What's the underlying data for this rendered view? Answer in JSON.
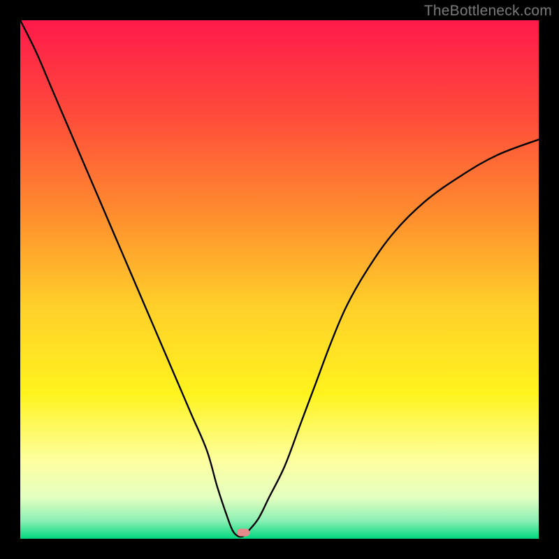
{
  "watermark": "TheBottleneck.com",
  "chart_data": {
    "type": "line",
    "title": "",
    "xlabel": "",
    "ylabel": "",
    "xlim": [
      0,
      100
    ],
    "ylim": [
      0,
      100
    ],
    "grid": false,
    "legend": false,
    "background": {
      "type": "vertical-gradient",
      "stops": [
        {
          "offset": 0.0,
          "color": "#ff1a4b"
        },
        {
          "offset": 0.18,
          "color": "#ff4a3b"
        },
        {
          "offset": 0.38,
          "color": "#ff8f2e"
        },
        {
          "offset": 0.55,
          "color": "#ffcf2a"
        },
        {
          "offset": 0.72,
          "color": "#fff31e"
        },
        {
          "offset": 0.85,
          "color": "#fdffa0"
        },
        {
          "offset": 0.92,
          "color": "#e4ffc0"
        },
        {
          "offset": 0.965,
          "color": "#8cf0b4"
        },
        {
          "offset": 1.0,
          "color": "#00d77f"
        }
      ]
    },
    "curve": {
      "x": [
        0,
        3,
        6,
        9,
        12,
        15,
        18,
        21,
        24,
        27,
        30,
        33,
        36,
        38,
        40,
        41,
        42,
        43,
        44,
        46,
        48,
        51,
        54,
        57,
        60,
        63,
        67,
        72,
        78,
        85,
        92,
        100
      ],
      "y": [
        100,
        94,
        87,
        80,
        73,
        66,
        59,
        52,
        45,
        38,
        31,
        24,
        17,
        10,
        4,
        1.5,
        0.5,
        0.5,
        1.5,
        4,
        8,
        14,
        22,
        30,
        38,
        45,
        52,
        59,
        65,
        70,
        74,
        77
      ],
      "note": "V-shaped bottleneck curve; minimum near x≈42, flat segment at bottom ~41–44"
    },
    "marker": {
      "x": 43,
      "y": 1.2,
      "color": "#e58a8a",
      "shape": "rounded-rect"
    }
  }
}
